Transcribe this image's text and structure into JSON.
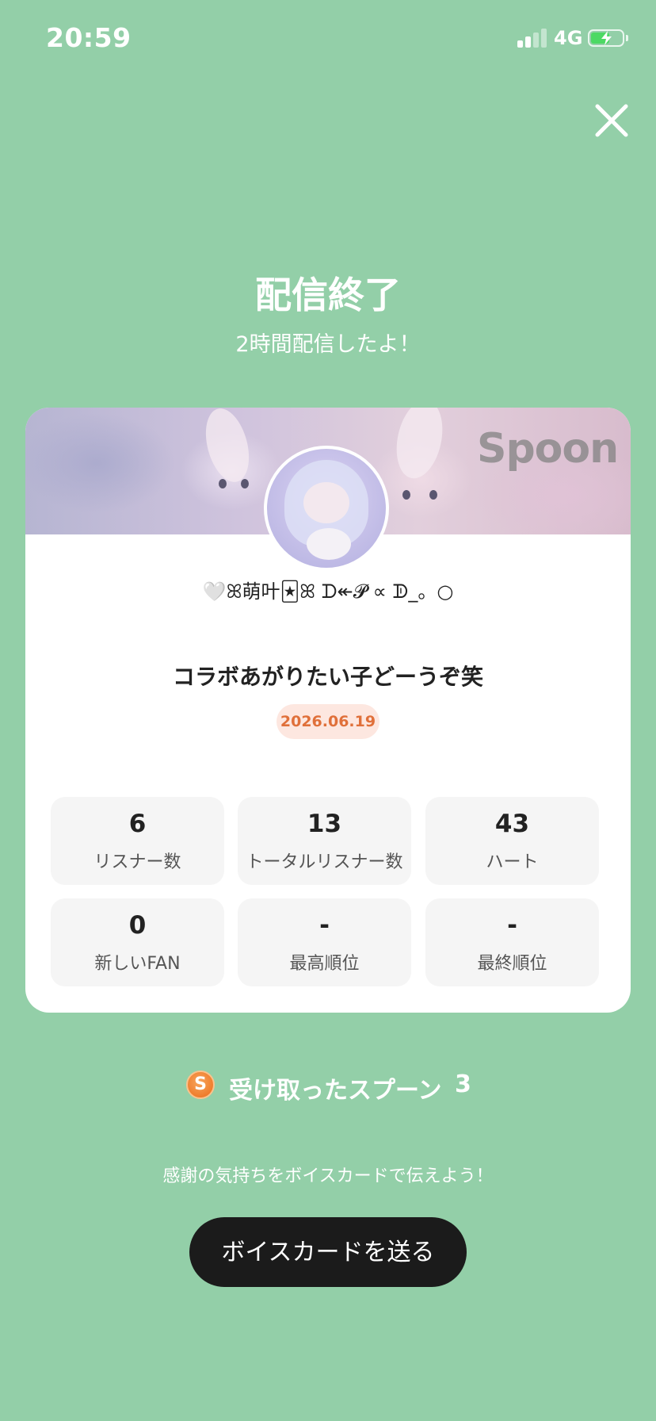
{
  "status_bar": {
    "time": "20:59",
    "network": "4G",
    "battery_charging": true,
    "battery_level": 0.6
  },
  "header": {
    "title": "配信終了",
    "subtitle": "2時間配信したよ！"
  },
  "card": {
    "watermark": "Spoon",
    "username": "🤍ꕤ萌叶🃏ꕤ ᗪ↞𝓟 ∝ ᗫ_。○",
    "stream_title": "コラボあがりたい子どーうぞ笑",
    "date": "2026.06.19",
    "stats": [
      {
        "value": "6",
        "label": "リスナー数"
      },
      {
        "value": "13",
        "label": "トータルリスナー数"
      },
      {
        "value": "43",
        "label": "ハート"
      },
      {
        "value": "0",
        "label": "新しいFAN"
      },
      {
        "value": "-",
        "label": "最高順位"
      },
      {
        "value": "-",
        "label": "最終順位"
      }
    ]
  },
  "spoons": {
    "coin_letter": "S",
    "label": "受け取ったスプーン",
    "count": "3"
  },
  "footer": {
    "thanks_text": "感謝の気持ちをボイスカードで伝えよう！",
    "voice_card_button": "ボイスカードを送る"
  },
  "colors": {
    "background": "#93cfa8",
    "accent_orange": "#e0703a",
    "button_dark": "#1b1b1b"
  }
}
